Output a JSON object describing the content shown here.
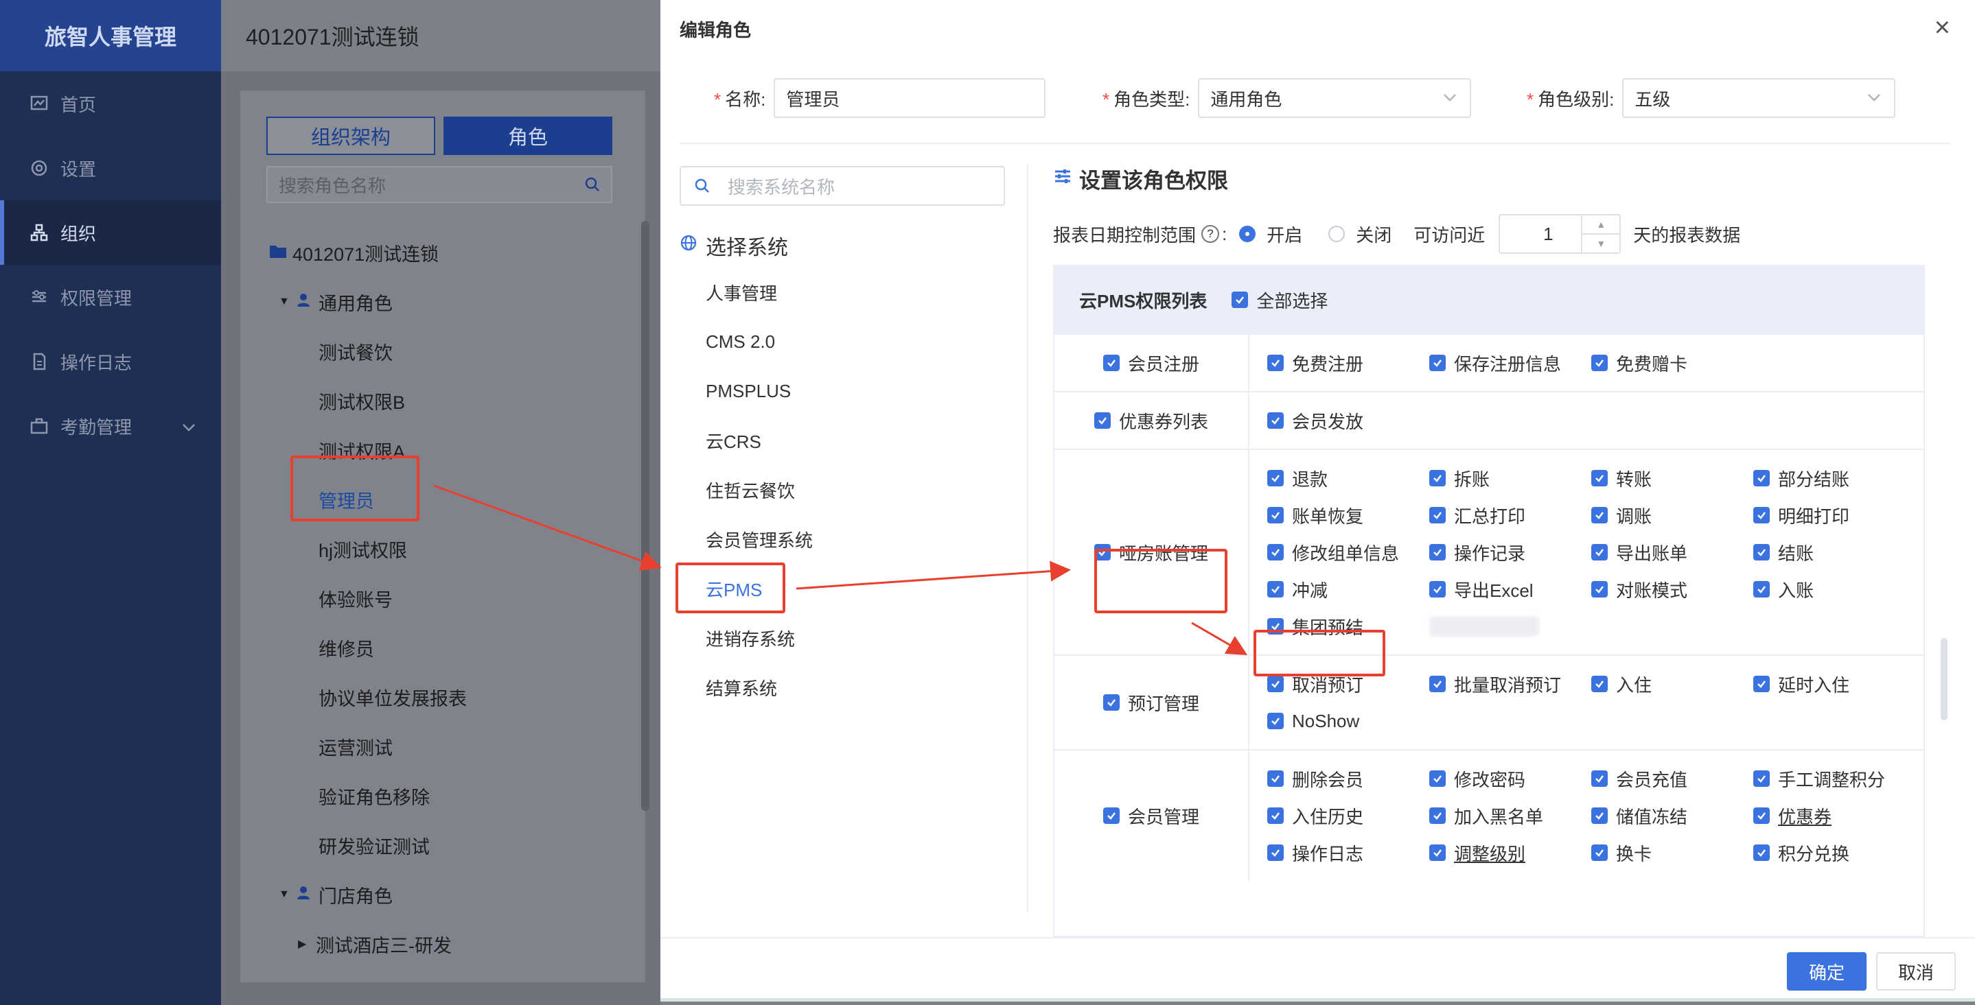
{
  "app": {
    "brand": "旅智人事管理",
    "header_title": "4012071测试连锁"
  },
  "sidebar": {
    "items": [
      {
        "label": "首页",
        "icon": "chart-icon"
      },
      {
        "label": "设置",
        "icon": "gear-icon"
      },
      {
        "label": "组织",
        "icon": "org-icon",
        "active": true
      },
      {
        "label": "权限管理",
        "icon": "sliders-icon"
      },
      {
        "label": "操作日志",
        "icon": "document-icon"
      },
      {
        "label": "考勤管理",
        "icon": "briefcase-icon"
      }
    ]
  },
  "left_panel": {
    "tab_org": "组织架构",
    "tab_role": "角色",
    "search_placeholder": "搜索角色名称",
    "tree_root": "4012071测试连锁",
    "group_general": "通用角色",
    "general_roles": [
      "测试餐饮",
      "测试权限B",
      "测试权限A",
      "管理员",
      "hj测试权限",
      "体验账号",
      "维修员",
      "协议单位发展报表",
      "运营测试",
      "验证角色移除",
      "研发验证测试"
    ],
    "group_store": "门店角色",
    "store_child": "测试酒店三-研发"
  },
  "modal": {
    "title": "编辑角色",
    "close": "×",
    "name_label": "名称:",
    "name_value": "管理员",
    "type_label": "角色类型:",
    "type_value": "通用角色",
    "level_label": "角色级别:",
    "level_value": "五级",
    "sys_search_placeholder": "搜索系统名称",
    "select_system": "选择系统",
    "systems": [
      "人事管理",
      "CMS 2.0",
      "PMSPLUS",
      "云CRS",
      "住哲云餐饮",
      "会员管理系统",
      "云PMS",
      "进销存系统",
      "结算系统"
    ],
    "active_system": "云PMS",
    "perm_title": "设置该角色权限",
    "report_label": "报表日期控制范围",
    "help": "?",
    "colon": ":",
    "radio_on": "开启",
    "radio_off": "关闭",
    "access_label": "可访问近",
    "days_value": "1",
    "days_suffix": "天的报表数据",
    "table_title": "云PMS权限列表",
    "select_all": "全部选择",
    "ok": "确定",
    "cancel": "取消"
  },
  "permissions": [
    {
      "category": "会员注册",
      "items": [
        "免费注册",
        "保存注册信息",
        "免费赠卡"
      ]
    },
    {
      "category": "优惠券列表",
      "items": [
        "会员发放"
      ]
    },
    {
      "category": "哑房账管理",
      "items": [
        "退款",
        "拆账",
        "转账",
        "部分结账",
        "账单恢复",
        "汇总打印",
        "调账",
        "明细打印",
        "修改组单信息",
        "操作记录",
        "导出账单",
        "结账",
        "冲减",
        "导出Excel",
        "对账模式",
        "入账",
        "集团预结"
      ]
    },
    {
      "category": "预订管理",
      "items": [
        "取消预订",
        "批量取消预订",
        "入住",
        "延时入住",
        "NoShow"
      ]
    },
    {
      "category": "会员管理",
      "items": [
        "删除会员",
        "修改密码",
        "会员充值",
        "手工调整积分",
        "入住历史",
        "加入黑名单",
        "储值冻结",
        "优惠券",
        "操作日志",
        "调整级别",
        "换卡",
        "积分兑换"
      ]
    }
  ],
  "colors": {
    "accent": "#3a73e0",
    "annotation": "#e8402f",
    "sidebar_bg": "#1f2f54"
  }
}
